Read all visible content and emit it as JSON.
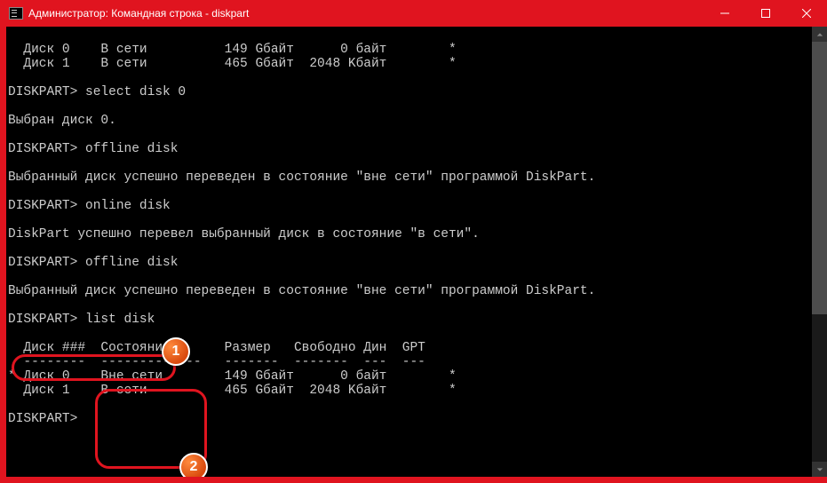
{
  "window": {
    "title": "Администратор: Командная строка - diskpart"
  },
  "badges": {
    "one": "1",
    "two": "2"
  },
  "lines": {
    "l01": "  Диск 0    В сети          149 Gбайт      0 байт        *",
    "l02": "  Диск 1    В сети          465 Gбайт  2048 Kбайт        *",
    "l03": "",
    "l04": "DISKPART> select disk 0",
    "l05": "",
    "l06": "Выбран диск 0.",
    "l07": "",
    "l08": "DISKPART> offline disk",
    "l09": "",
    "l10": "Выбранный диск успешно переведен в состояние \"вне сети\" программой DiskPart.",
    "l11": "",
    "l12": "DISKPART> online disk",
    "l13": "",
    "l14": "DiskPart успешно перевел выбранный диск в состояние \"в сети\".",
    "l15": "",
    "l16": "DISKPART> offline disk",
    "l17": "",
    "l18": "Выбранный диск успешно переведен в состояние \"вне сети\" программой DiskPart.",
    "l19": "",
    "l20": "DISKPART> list disk",
    "l21": "",
    "l22": "  Диск ###  Состояние       Размер   Свободно Дин  GPT",
    "l23": "  --------  -------------   -------  -------  ---  ---",
    "l24": "* Диск 0    Вне сети        149 Gбайт      0 байт        *",
    "l25": "  Диск 1    В сети          465 Gбайт  2048 Kбайт        *",
    "l26": "",
    "l27": "DISKPART>"
  },
  "chart_data": {
    "type": "table",
    "title": "DISKPART list disk",
    "columns": [
      "Диск ###",
      "Состояние",
      "Размер",
      "Свободно",
      "Дин",
      "GPT"
    ],
    "rows": [
      {
        "selected": true,
        "disk": "Диск 0",
        "state": "Вне сети",
        "size": "149 Gбайт",
        "free": "0 байт",
        "dyn": "",
        "gpt": "*"
      },
      {
        "selected": false,
        "disk": "Диск 1",
        "state": "В сети",
        "size": "465 Gбайт",
        "free": "2048 Kбайт",
        "dyn": "",
        "gpt": "*"
      }
    ]
  }
}
